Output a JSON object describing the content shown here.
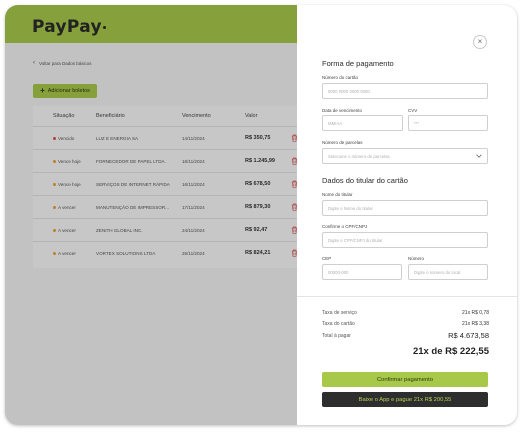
{
  "brand": {
    "name": "PayPay"
  },
  "back_link": {
    "label": "Voltar para Dados básicos"
  },
  "add_button": {
    "label": "Adicionar boletos"
  },
  "table": {
    "headers": {
      "status": "Situação",
      "beneficiary": "Beneficiário",
      "due": "Vencimento",
      "value": "Valor"
    },
    "rows": [
      {
        "status": "Vencido",
        "status_color": "#d9534f",
        "beneficiary": "LUZ E ENERGIA SA",
        "due": "14/11/2024",
        "value": "R$ 350,75"
      },
      {
        "status": "Vence hoje",
        "status_color": "#f0a030",
        "beneficiary": "FORNECEDOR DE PAPEL LTDA.",
        "due": "16/11/2024",
        "value": "R$ 1.245,99"
      },
      {
        "status": "Vence hoje",
        "status_color": "#f0a030",
        "beneficiary": "SERVIÇOS DE INTERNET RÁPIDA",
        "due": "16/11/2024",
        "value": "R$ 678,50"
      },
      {
        "status": "A vencer",
        "status_color": "#f0a030",
        "beneficiary": "MANUTENÇÃO DE IMPRESSOR...",
        "due": "17/11/2024",
        "value": "R$ 879,30"
      },
      {
        "status": "A vencer",
        "status_color": "#f0a030",
        "beneficiary": "ZENITH GLOBAL INC.",
        "due": "24/11/2024",
        "value": "R$ 92,47"
      },
      {
        "status": "A vencer",
        "status_color": "#f0a030",
        "beneficiary": "VORTEX SOLUTIONS LTDA",
        "due": "26/11/2024",
        "value": "R$ 824,21"
      }
    ]
  },
  "payment_form": {
    "title": "Forma de pagamento",
    "card_number": {
      "label": "Número do cartão",
      "placeholder": "0000 0000 0000 0000"
    },
    "expiry": {
      "label": "Data de vencimento",
      "placeholder": "MM/AA"
    },
    "cvv": {
      "label": "CVV",
      "placeholder": "***"
    },
    "installments": {
      "label": "Número de parcelas",
      "placeholder": "Selecione o número de parcelas"
    }
  },
  "holder_form": {
    "title": "Dados do titular do cartão",
    "name": {
      "label": "Nome do titular",
      "placeholder": "Digite o Nome do titular"
    },
    "document": {
      "label": "Confirme o CPF/CNPJ",
      "placeholder": "Digite o CPF/CNPJ do titular"
    },
    "cep": {
      "label": "CEP",
      "placeholder": "00000-000"
    },
    "number": {
      "label": "Número",
      "placeholder": "Digite o número do local"
    }
  },
  "summary": {
    "service_fee_label": "Taxa de serviço",
    "service_fee_value": "21x R$ 0,78",
    "card_fee_label": "Taxa do cartão",
    "card_fee_value": "21x R$ 3,38",
    "total_label": "Total à pagar",
    "total_value": "R$ 4.673,58",
    "installment_value": "21x de R$ 222,55"
  },
  "actions": {
    "confirm_label": "Confirmar pagamento",
    "app_label": "Baixe o App e pague 21x R$ 200,55"
  },
  "colors": {
    "brand_green": "#a8c84a",
    "dark_button": "#2e2e2e",
    "danger": "#d9534f",
    "warning": "#f0a030"
  }
}
